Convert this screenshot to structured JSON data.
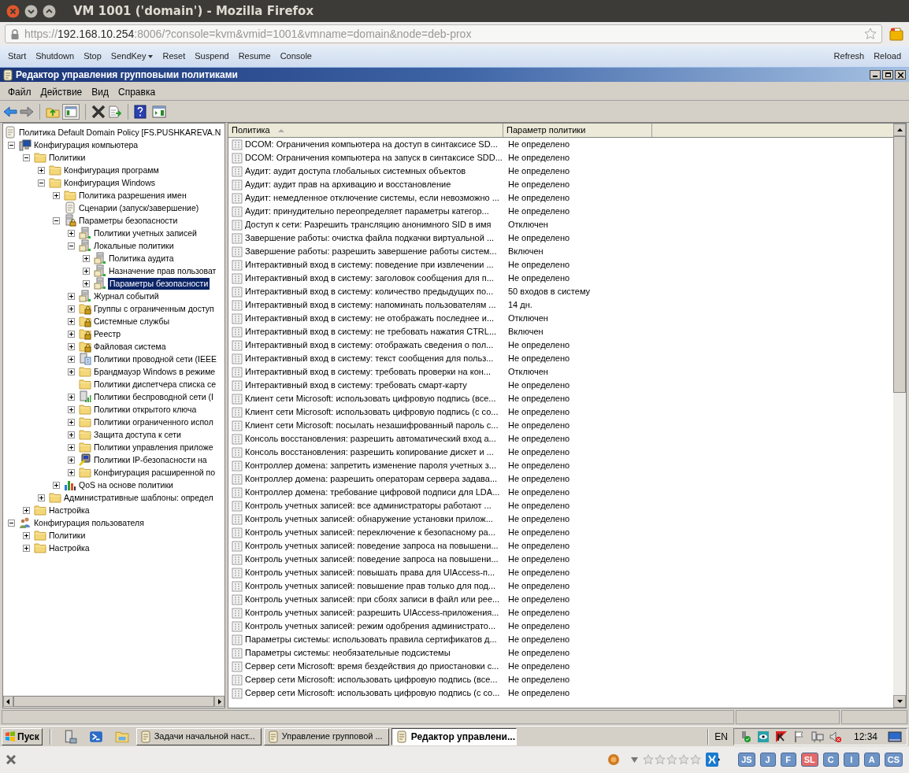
{
  "browser": {
    "title": "VM 1001 ('domain') - Mozilla Firefox",
    "url": {
      "scheme": "https://",
      "host": "192.168.10.254",
      "rest": ":8006/?console=kvm&vmid=1001&vmname=domain&node=deb-prox"
    }
  },
  "console_toolbar": {
    "left": [
      {
        "label": "Start"
      },
      {
        "label": "Shutdown"
      },
      {
        "label": "Stop"
      },
      {
        "label": "SendKey",
        "menu": true
      },
      {
        "label": "Reset"
      },
      {
        "label": "Suspend"
      },
      {
        "label": "Resume"
      },
      {
        "label": "Console"
      }
    ],
    "right": [
      {
        "label": "Refresh"
      },
      {
        "label": "Reload"
      }
    ]
  },
  "app": {
    "title": "Редактор управления групповыми политиками",
    "menu": [
      "Файл",
      "Действие",
      "Вид",
      "Справка"
    ]
  },
  "tree": [
    {
      "label": "Политика Default Domain Policy [FS.PUSHKAREVA.N",
      "kind": "script",
      "children": [
        {
          "label": "Конфигурация компьютера",
          "kind": "computer",
          "expanded": true,
          "children": [
            {
              "label": "Политики",
              "kind": "folder",
              "expanded": true,
              "children": [
                {
                  "label": "Конфигурация программ",
                  "kind": "folder",
                  "expanded": false
                },
                {
                  "label": "Конфигурация Windows",
                  "kind": "folder",
                  "expanded": true,
                  "children": [
                    {
                      "label": "Политика разрешения имен",
                      "kind": "folder",
                      "expanded": false
                    },
                    {
                      "label": "Сценарии (запуск/завершение)",
                      "kind": "script"
                    },
                    {
                      "label": "Параметры безопасности",
                      "kind": "secure",
                      "expanded": true,
                      "children": [
                        {
                          "label": "Политики учетных записей",
                          "kind": "server",
                          "expanded": false
                        },
                        {
                          "label": "Локальные политики",
                          "kind": "server",
                          "expanded": true,
                          "children": [
                            {
                              "label": "Политика аудита",
                              "kind": "server",
                              "expanded": false
                            },
                            {
                              "label": "Назначение прав пользоват",
                              "kind": "server",
                              "expanded": false
                            },
                            {
                              "label": "Параметры безопасности",
                              "kind": "server",
                              "expanded": false,
                              "selected": true
                            }
                          ]
                        },
                        {
                          "label": "Журнал событий",
                          "kind": "server",
                          "expanded": false
                        },
                        {
                          "label": "Группы с ограниченным доступ",
                          "kind": "lock-folder",
                          "expanded": false
                        },
                        {
                          "label": "Системные службы",
                          "kind": "lock-folder",
                          "expanded": false
                        },
                        {
                          "label": "Реестр",
                          "kind": "lock-folder",
                          "expanded": false
                        },
                        {
                          "label": "Файловая система",
                          "kind": "lock-folder",
                          "expanded": false
                        },
                        {
                          "label": "Политики проводной сети (IEEE",
                          "kind": "network",
                          "expanded": false
                        },
                        {
                          "label": "Брандмауэр Windows в режиме",
                          "kind": "folder",
                          "expanded": false
                        },
                        {
                          "label": "Политики диспетчера списка се",
                          "kind": "folder"
                        },
                        {
                          "label": "Политики беспроводной сети (I",
                          "kind": "wireless",
                          "expanded": false
                        },
                        {
                          "label": "Политики открытого ключа",
                          "kind": "folder",
                          "expanded": false
                        },
                        {
                          "label": "Политики ограниченного испол",
                          "kind": "folder",
                          "expanded": false
                        },
                        {
                          "label": "Защита доступа к сети",
                          "kind": "folder",
                          "expanded": false
                        },
                        {
                          "label": "Политики управления приложе",
                          "kind": "folder",
                          "expanded": false
                        },
                        {
                          "label": "Политики IP-безопасности на",
                          "kind": "ip",
                          "expanded": false
                        },
                        {
                          "label": "Конфигурация расширенной по",
                          "kind": "folder",
                          "expanded": false
                        }
                      ]
                    },
                    {
                      "label": "QoS на основе политики",
                      "kind": "chart",
                      "expanded": false
                    }
                  ]
                },
                {
                  "label": "Административные шаблоны: определ",
                  "kind": "folder",
                  "expanded": false
                }
              ]
            },
            {
              "label": "Настройка",
              "kind": "folder",
              "expanded": false
            }
          ]
        },
        {
          "label": "Конфигурация пользователя",
          "kind": "user",
          "expanded": true,
          "children": [
            {
              "label": "Политики",
              "kind": "folder",
              "expanded": false
            },
            {
              "label": "Настройка",
              "kind": "folder",
              "expanded": false
            }
          ]
        }
      ]
    }
  ],
  "table": {
    "columns": [
      {
        "label": "Политика",
        "sorted": true
      },
      {
        "label": "Параметр политики",
        "sorted": false
      }
    ],
    "rows": [
      [
        "DCOM: Ограничения компьютера на доступ в синтаксисе SD...",
        "Не определено"
      ],
      [
        "DCOM: Ограничения компьютера на запуск в синтаксисе SDD...",
        "Не определено"
      ],
      [
        "Аудит: аудит доступа глобальных системных объектов",
        "Не определено"
      ],
      [
        "Аудит: аудит прав на архивацию и восстановление",
        "Не определено"
      ],
      [
        "Аудит: немедленное отключение системы, если невозможно ...",
        "Не определено"
      ],
      [
        "Аудит: принудительно переопределяет параметры категор...",
        "Не определено"
      ],
      [
        "Доступ к сети: Разрешить трансляцию анонимного SID в имя",
        "Отключен"
      ],
      [
        "Завершение работы: очистка файла подкачки виртуальной ...",
        "Не определено"
      ],
      [
        "Завершение работы: разрешить завершение работы систем...",
        "Включен"
      ],
      [
        "Интерактивный вход в систему:  поведение при извлечении ...",
        "Не определено"
      ],
      [
        "Интерактивный вход в систему: заголовок сообщения для п...",
        "Не определено"
      ],
      [
        "Интерактивный вход в систему: количество предыдущих по...",
        "50 входов в систему"
      ],
      [
        "Интерактивный вход в систему: напоминать пользователям ...",
        "14 дн."
      ],
      [
        "Интерактивный вход в систему: не отображать последнее и...",
        "Отключен"
      ],
      [
        "Интерактивный вход в систему: не требовать нажатия CTRL...",
        "Включен"
      ],
      [
        "Интерактивный вход в систему: отображать сведения о пол...",
        "Не определено"
      ],
      [
        "Интерактивный вход в систему: текст сообщения для польз...",
        "Не определено"
      ],
      [
        "Интерактивный вход в систему: требовать проверки на кон...",
        "Отключен"
      ],
      [
        "Интерактивный вход в систему: требовать смарт-карту",
        "Не определено"
      ],
      [
        "Клиент сети Microsoft: использовать цифровую подпись (все...",
        "Не определено"
      ],
      [
        "Клиент сети Microsoft: использовать цифровую подпись (с со...",
        "Не определено"
      ],
      [
        "Клиент сети Microsoft: посылать незашифрованный пароль с...",
        "Не определено"
      ],
      [
        "Консоль восстановления: разрешить автоматический вход а...",
        "Не определено"
      ],
      [
        "Консоль восстановления: разрешить копирование дискет и ...",
        "Не определено"
      ],
      [
        "Контроллер домена: запретить изменение пароля учетных з...",
        "Не определено"
      ],
      [
        "Контроллер домена: разрешить операторам сервера задава...",
        "Не определено"
      ],
      [
        "Контроллер домена: требование цифровой подписи для LDA...",
        "Не определено"
      ],
      [
        "Контроль учетных записей: все администраторы работают ...",
        "Не определено"
      ],
      [
        "Контроль учетных записей: обнаружение установки прилож...",
        "Не определено"
      ],
      [
        "Контроль учетных записей: переключение к безопасному ра...",
        "Не определено"
      ],
      [
        "Контроль учетных записей: поведение запроса на повышени...",
        "Не определено"
      ],
      [
        "Контроль учетных записей: поведение запроса на повышени...",
        "Не определено"
      ],
      [
        "Контроль учетных записей: повышать права для UIAccess-п...",
        "Не определено"
      ],
      [
        "Контроль учетных записей: повышение прав только для под...",
        "Не определено"
      ],
      [
        "Контроль учетных записей: при сбоях записи в файл или рее...",
        "Не определено"
      ],
      [
        "Контроль учетных записей: разрешить UIAccess-приложения...",
        "Не определено"
      ],
      [
        "Контроль учетных записей: режим одобрения администрато...",
        "Не определено"
      ],
      [
        "Параметры системы: использовать правила сертификатов д...",
        "Не определено"
      ],
      [
        "Параметры системы: необязательные подсистемы",
        "Не определено"
      ],
      [
        "Сервер сети Microsoft: время бездействия до приостановки с...",
        "Не определено"
      ],
      [
        "Сервер сети Microsoft: использовать цифровую подпись (все...",
        "Не определено"
      ],
      [
        "Сервер сети Microsoft: использовать цифровую подпись (с со...",
        "Не определено"
      ]
    ]
  },
  "taskbar": {
    "start": "Пуск",
    "tasks": [
      {
        "label": "Задачи начальной наст...",
        "selected": false
      },
      {
        "label": "Управление групповой ...",
        "selected": false
      },
      {
        "label": "Редактор управлени...",
        "selected": true
      }
    ],
    "language": "EN",
    "clock": "12:34"
  },
  "addon_bar": {
    "stars": 0,
    "badges": [
      {
        "label": "JS",
        "color": "#6e94c6"
      },
      {
        "label": "J",
        "color": "#6e94c6"
      },
      {
        "label": "F",
        "color": "#6e94c6"
      },
      {
        "label": "SL",
        "color": "#e26a6a"
      },
      {
        "label": "C",
        "color": "#6e94c6"
      },
      {
        "label": "I",
        "color": "#6e94c6"
      },
      {
        "label": "A",
        "color": "#6e94c6"
      },
      {
        "label": "CS",
        "color": "#6e94c6"
      }
    ]
  }
}
